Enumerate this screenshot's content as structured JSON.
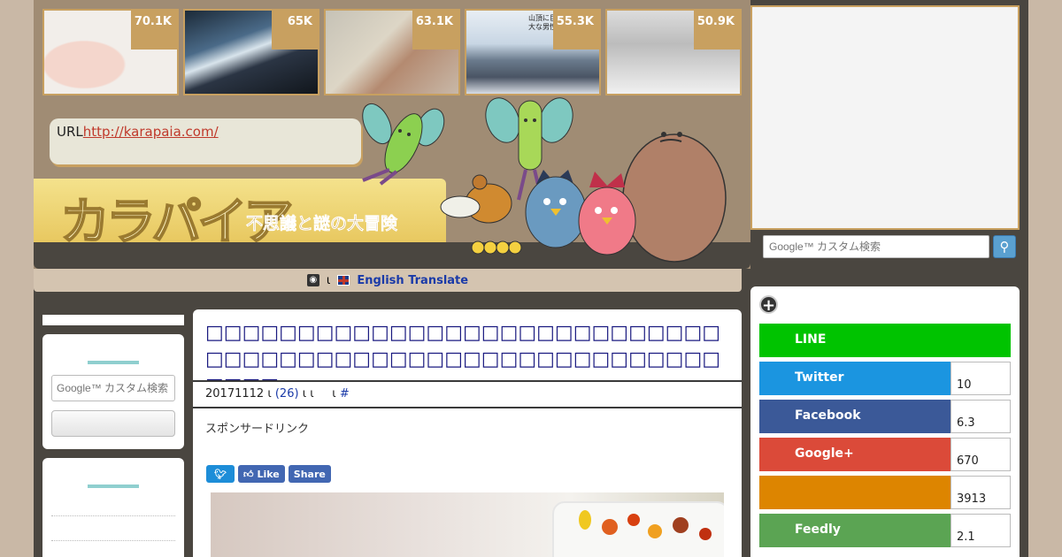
{
  "thumbnails": [
    {
      "count": "70.1K",
      "overlay": ""
    },
    {
      "count": "65K",
      "overlay": ""
    },
    {
      "count": "63.1K",
      "overlay": ""
    },
    {
      "count": "55.3K",
      "overlay": "山頂に巨\n大な男性器"
    },
    {
      "count": "50.9K",
      "overlay": ""
    }
  ],
  "url_box": {
    "prefix": "URL",
    "link": "http://karapaia.com/"
  },
  "logo": {
    "mark": "カラパイア",
    "tagline": "不思議と謎の大冒険"
  },
  "translate": {
    "sep": "ι",
    "label": "English Translate"
  },
  "left_search": {
    "placeholder": "Google™ カスタム検索"
  },
  "article": {
    "title": "□□□□□□□□□□□□□□□□□□□□□□□□□□□□□□□□□□□□□□□□□□□□□□□□□□□□□□□□□□□□",
    "meta_date": "20171112",
    "meta_sep1": "ι",
    "meta_comments": "(26)",
    "meta_sep2": "ι ι",
    "meta_sep3": "ι",
    "meta_hash": "#",
    "sponsored": "スポンサードリンク",
    "share_like": "Like",
    "share_share": "Share"
  },
  "gsearch": {
    "placeholder": "Google™ カスタム検索"
  },
  "social": [
    {
      "name": "LINE",
      "count": "",
      "color": "#00c300"
    },
    {
      "name": "Twitter",
      "count": "10",
      "color": "#1b95e0"
    },
    {
      "name": "Facebook",
      "count": "6.3",
      "color": "#3b5998"
    },
    {
      "name": "Google+",
      "count": "670",
      "color": "#db4a39"
    },
    {
      "name": "",
      "count": "3913",
      "color": "#dd8500"
    },
    {
      "name": "Feedly",
      "count": "2.1",
      "color": "#5ba453"
    }
  ]
}
